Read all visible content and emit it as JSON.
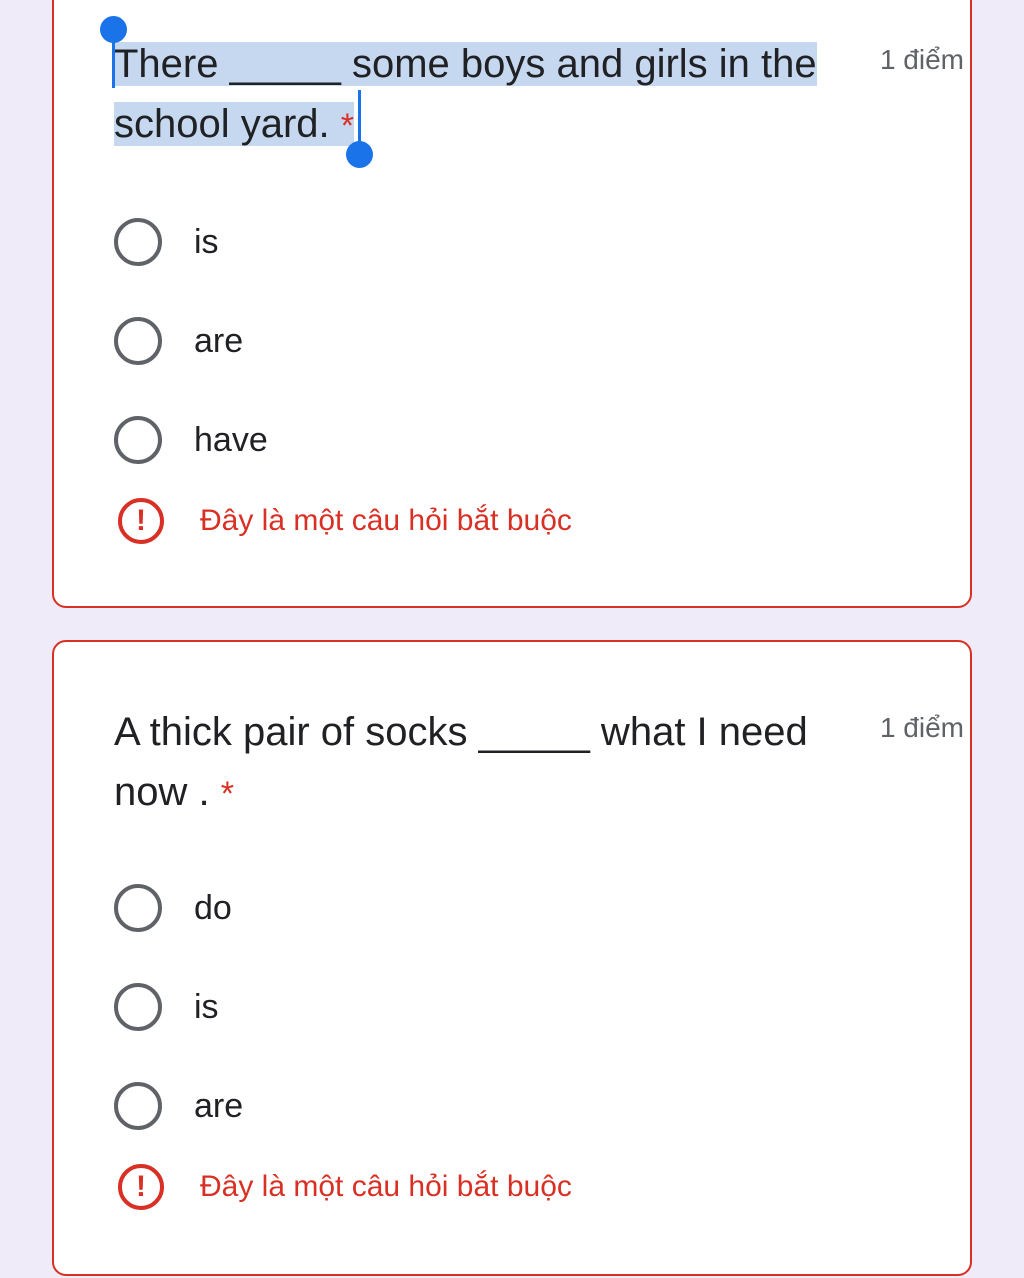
{
  "questions": [
    {
      "line1": "There _____ some boys and girls in the",
      "line2": "school yard.",
      "required_mark": "*",
      "points": "1 điểm",
      "options": [
        "is",
        "are",
        "have"
      ],
      "error": "Đây là một câu hỏi bắt buộc"
    },
    {
      "line1": "A thick pair of socks _____ what I need",
      "line2": "now .",
      "required_mark": "*",
      "points": "1 điểm",
      "options": [
        "do",
        "is",
        "are"
      ],
      "error": "Đây là một câu hỏi bắt buộc"
    }
  ],
  "error_icon": "!",
  "colors": {
    "background": "#f0ebf8",
    "error": "#d93025",
    "selection": "#c6d8ef",
    "handle": "#1a73e8"
  }
}
